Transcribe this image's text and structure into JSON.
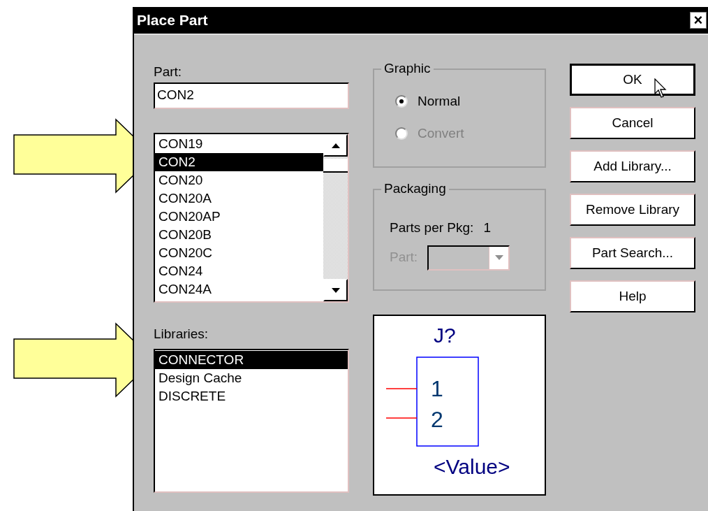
{
  "window": {
    "title": "Place Part",
    "close": "×"
  },
  "part_field": {
    "label": "Part:",
    "value": "CON2"
  },
  "parts_list": {
    "items": [
      {
        "label": "CON19",
        "selected": false
      },
      {
        "label": "CON2",
        "selected": true
      },
      {
        "label": "CON20",
        "selected": false
      },
      {
        "label": "CON20A",
        "selected": false
      },
      {
        "label": "CON20AP",
        "selected": false
      },
      {
        "label": "CON20B",
        "selected": false
      },
      {
        "label": "CON20C",
        "selected": false
      },
      {
        "label": "CON24",
        "selected": false
      },
      {
        "label": "CON24A",
        "selected": false
      }
    ]
  },
  "libraries": {
    "label": "Libraries:",
    "items": [
      {
        "label": "CONNECTOR",
        "selected": true
      },
      {
        "label": "Design Cache",
        "selected": false
      },
      {
        "label": "DISCRETE",
        "selected": false
      }
    ]
  },
  "graphic": {
    "title": "Graphic",
    "options": [
      {
        "label": "Normal",
        "selected": true,
        "disabled": false
      },
      {
        "label": "Convert",
        "selected": false,
        "disabled": true
      }
    ]
  },
  "packaging": {
    "title": "Packaging",
    "parts_per_pkg_label": "Parts per Pkg:",
    "parts_per_pkg": "1",
    "part_label": "Part:",
    "part_disabled": true
  },
  "preview": {
    "refdes": "J?",
    "pins": [
      {
        "number": "1"
      },
      {
        "number": "2"
      }
    ],
    "value": "<Value>"
  },
  "buttons": [
    {
      "label": "OK",
      "default": true
    },
    {
      "label": "Cancel",
      "default": false
    },
    {
      "label": "Add Library...",
      "default": false
    },
    {
      "label": "Remove Library",
      "default": false
    },
    {
      "label": "Part Search...",
      "default": false
    },
    {
      "label": "Help",
      "default": false
    }
  ],
  "annotations": [
    {
      "kind": "arrow"
    },
    {
      "kind": "arrow"
    }
  ]
}
